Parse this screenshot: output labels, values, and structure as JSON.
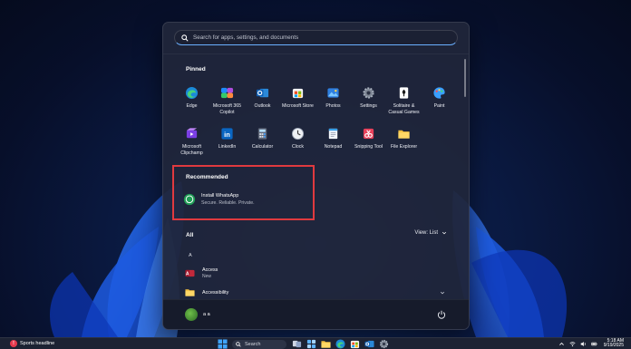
{
  "search": {
    "placeholder": "Search for apps, settings, and documents"
  },
  "pinned": {
    "title": "Pinned",
    "apps": [
      {
        "label": "Edge",
        "icon": "edge-icon"
      },
      {
        "label": "Microsoft 365 Copilot",
        "icon": "copilot-icon"
      },
      {
        "label": "Outlook",
        "icon": "outlook-icon"
      },
      {
        "label": "Microsoft Store",
        "icon": "store-icon"
      },
      {
        "label": "Photos",
        "icon": "photos-icon"
      },
      {
        "label": "Settings",
        "icon": "gear-icon"
      },
      {
        "label": "Solitaire & Casual Games",
        "icon": "solitaire-icon"
      },
      {
        "label": "Paint",
        "icon": "paint-icon"
      },
      {
        "label": "Microsoft Clipchamp",
        "icon": "clipchamp-icon"
      },
      {
        "label": "LinkedIn",
        "icon": "linkedin-icon"
      },
      {
        "label": "Calculator",
        "icon": "calculator-icon"
      },
      {
        "label": "Clock",
        "icon": "clock-icon"
      },
      {
        "label": "Notepad",
        "icon": "notepad-icon"
      },
      {
        "label": "Snipping Tool",
        "icon": "snipping-tool-icon"
      },
      {
        "label": "File Explorer",
        "icon": "folder-icon"
      }
    ]
  },
  "recommended": {
    "title": "Recommended",
    "item": {
      "name": "Install WhatsApp",
      "description": "Secure. Reliable. Private.",
      "icon": "whatsapp-icon"
    }
  },
  "all_apps": {
    "title": "All",
    "view_label": "View: List",
    "letter": "A",
    "items": [
      {
        "name": "Access",
        "sub": "New",
        "icon": "access-icon"
      },
      {
        "name": "Accessibility",
        "sub": "",
        "icon": "folder-icon"
      }
    ]
  },
  "user": {
    "name": "a a"
  },
  "taskbar": {
    "news": "Sports headline",
    "search_label": "Search",
    "time": "5:18 AM",
    "date": "9/19/2025"
  },
  "colors": {
    "accent": "#6ab0ff",
    "highlight_box": "#e03a3f",
    "menu_bg": "#20263a"
  }
}
